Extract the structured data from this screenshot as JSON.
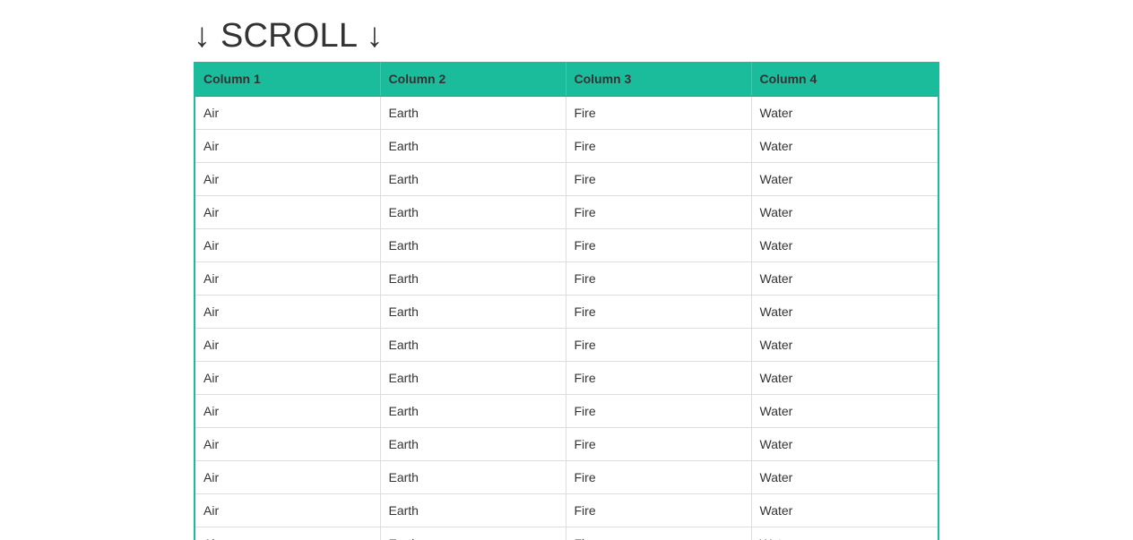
{
  "heading": "↓ SCROLL ↓",
  "table": {
    "columns": [
      "Column 1",
      "Column 2",
      "Column 3",
      "Column 4"
    ],
    "rows": [
      [
        "Air",
        "Earth",
        "Fire",
        "Water"
      ],
      [
        "Air",
        "Earth",
        "Fire",
        "Water"
      ],
      [
        "Air",
        "Earth",
        "Fire",
        "Water"
      ],
      [
        "Air",
        "Earth",
        "Fire",
        "Water"
      ],
      [
        "Air",
        "Earth",
        "Fire",
        "Water"
      ],
      [
        "Air",
        "Earth",
        "Fire",
        "Water"
      ],
      [
        "Air",
        "Earth",
        "Fire",
        "Water"
      ],
      [
        "Air",
        "Earth",
        "Fire",
        "Water"
      ],
      [
        "Air",
        "Earth",
        "Fire",
        "Water"
      ],
      [
        "Air",
        "Earth",
        "Fire",
        "Water"
      ],
      [
        "Air",
        "Earth",
        "Fire",
        "Water"
      ],
      [
        "Air",
        "Earth",
        "Fire",
        "Water"
      ],
      [
        "Air",
        "Earth",
        "Fire",
        "Water"
      ],
      [
        "Air",
        "Earth",
        "Fire",
        "Water"
      ]
    ]
  },
  "colors": {
    "accent": "#1abc9c",
    "text": "#333333",
    "row_border": "#dddddd"
  }
}
